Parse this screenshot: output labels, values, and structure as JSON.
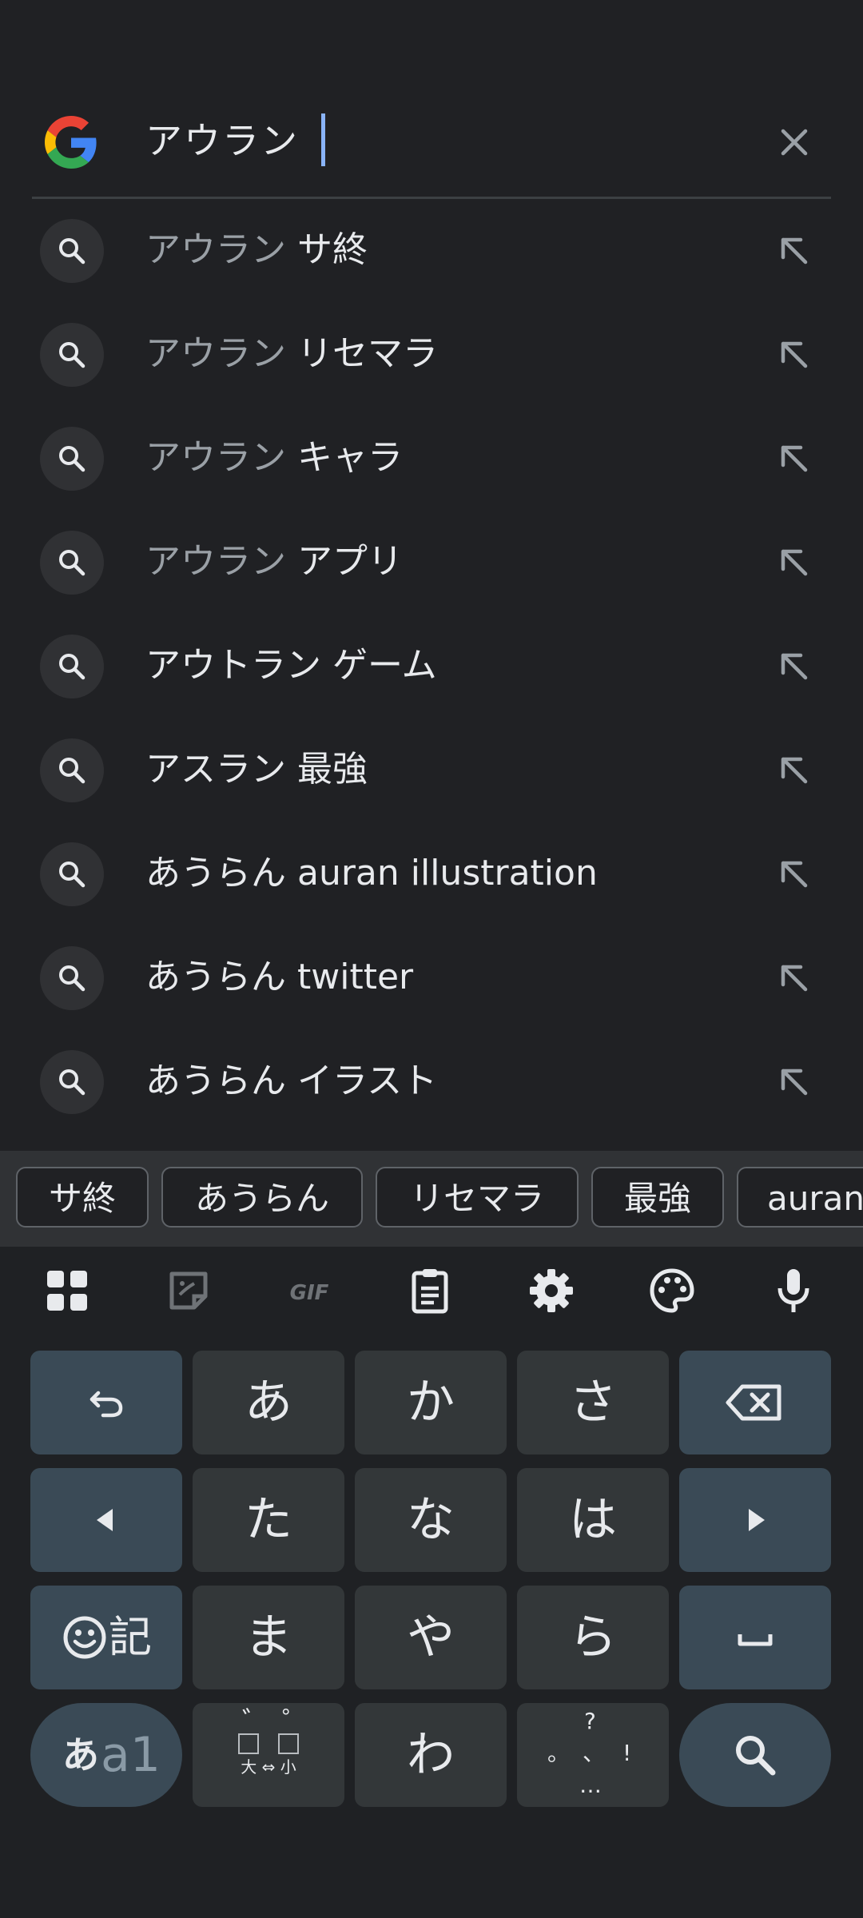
{
  "search": {
    "query": "アウラン",
    "logo": "google-g-logo",
    "clear_icon": "close-icon"
  },
  "suggestions": [
    {
      "prefix": "アウラン",
      "suffix": " サ終"
    },
    {
      "prefix": "アウラン",
      "suffix": " リセマラ"
    },
    {
      "prefix": "アウラン",
      "suffix": " キャラ"
    },
    {
      "prefix": "アウラン",
      "suffix": " アプリ"
    },
    {
      "prefix": "",
      "suffix": "アウトラン ゲーム"
    },
    {
      "prefix": "",
      "suffix": "アスラン 最強"
    },
    {
      "prefix": "",
      "suffix": "あうらん auran illustration"
    },
    {
      "prefix": "",
      "suffix": "あうらん twitter"
    },
    {
      "prefix": "",
      "suffix": "あうらん イラスト"
    }
  ],
  "candidates": [
    "サ終",
    "あうらん",
    "リセマラ",
    "最強",
    "auran"
  ],
  "keyboard": {
    "toolbar": [
      "apps-grid-icon",
      "sticker-icon",
      "gif-icon",
      "clipboard-icon",
      "settings-icon",
      "palette-icon",
      "microphone-icon"
    ],
    "gif_label": "GIF",
    "keys": {
      "a": "あ",
      "ka": "か",
      "sa": "さ",
      "ta": "た",
      "na": "な",
      "ha": "は",
      "ma": "ま",
      "ya": "や",
      "ra": "ら",
      "wa": "わ",
      "kigou": "記",
      "mode_kana": "あ",
      "mode_latin": "a1",
      "dakuten_label": "大 ⇔ 小",
      "dakuten": "゛",
      "handakuten": "゜",
      "punct_q": "?",
      "punct_excl": "!",
      "punct_dot": "。",
      "punct_comma": "、",
      "punct_ellipsis": "…"
    }
  },
  "colors": {
    "background": "#202124",
    "keyboard_bg": "#1f2124",
    "key_bg": "#333739",
    "function_key_bg": "#3a4a56",
    "caret": "#8ab4f8",
    "muted_text": "#9aa0a6"
  }
}
